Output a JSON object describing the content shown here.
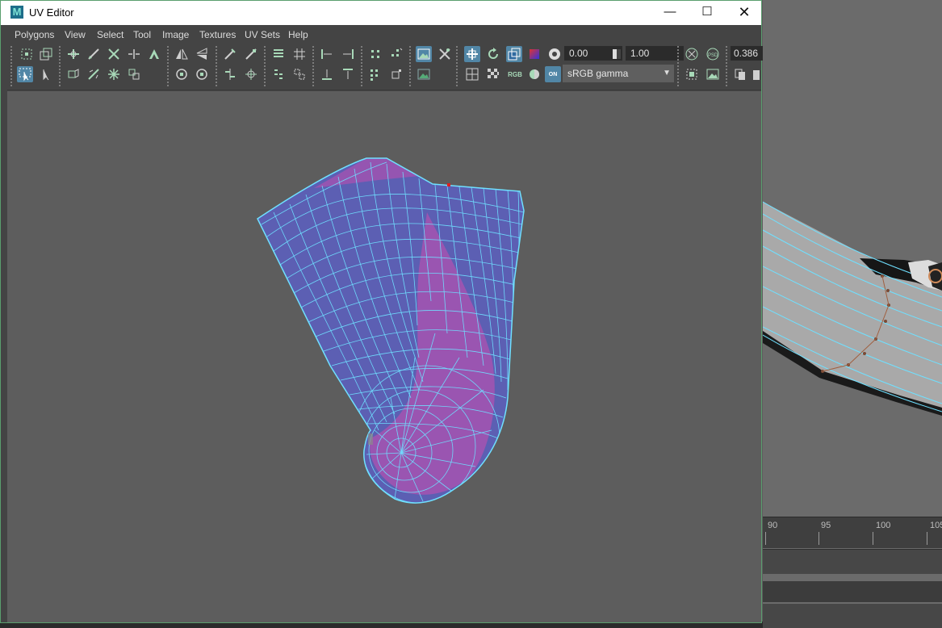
{
  "window": {
    "title": "UV Editor",
    "icon": "M"
  },
  "window_controls": {
    "minimize": "—",
    "maximize": "☐",
    "close": "✕"
  },
  "menu": [
    "Polygons",
    "View",
    "Select",
    "Tool",
    "Image",
    "Textures",
    "UV Sets",
    "Help"
  ],
  "toolbar": {
    "exposure_value": "0.00",
    "gamma_value": "1.00",
    "view_transform": "sRGB gamma",
    "rgb_label": "RGB",
    "on_label": "ON",
    "pixel_value": "0.386"
  },
  "timeline": {
    "ticks": [
      "90",
      "95",
      "100",
      "105"
    ]
  },
  "colors": {
    "uv_fill": "#5c5fb3",
    "uv_flipped_fill": "#a453b0",
    "uv_edge": "#6fe0ff",
    "selected_vertex": "#e01e1e",
    "active_icon_bg": "#5186a6",
    "window_border": "#5a9e6e"
  }
}
